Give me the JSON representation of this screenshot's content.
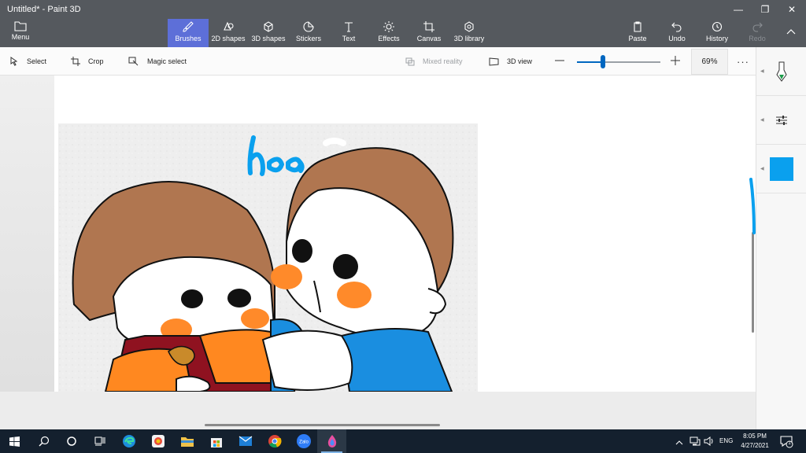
{
  "window": {
    "title": "Untitled* - Paint 3D",
    "minimize": "—",
    "maximize": "❐",
    "close": "✕"
  },
  "ribbon": {
    "menu_label": "Menu",
    "tools": [
      {
        "label": "Brushes"
      },
      {
        "label": "2D shapes"
      },
      {
        "label": "3D shapes"
      },
      {
        "label": "Stickers"
      },
      {
        "label": "Text"
      },
      {
        "label": "Effects"
      },
      {
        "label": "Canvas"
      },
      {
        "label": "3D library"
      }
    ],
    "actions": [
      {
        "label": "Paste"
      },
      {
        "label": "Undo"
      },
      {
        "label": "History"
      },
      {
        "label": "Redo"
      }
    ]
  },
  "toolbar": {
    "select_label": "Select",
    "crop_label": "Crop",
    "magic_select_label": "Magic select",
    "mixed_reality_label": "Mixed reality",
    "view_3d_label": "3D view",
    "zoom_value": "69%",
    "zoom_level": 0.69,
    "more_label": "···"
  },
  "canvas": {
    "sketch_text": "hoo"
  },
  "side_panel": {
    "active_color": "#0aa0ee"
  },
  "taskbar": {
    "apps": [
      "windows-start-icon",
      "search-icon",
      "cortana-icon",
      "task-view-icon",
      "edge-icon",
      "photos-icon",
      "file-explorer-icon",
      "store-icon",
      "mail-icon",
      "chrome-icon",
      "zalo-icon",
      "paint3d-icon"
    ],
    "zalo_label": "Zalo",
    "language": "ENG",
    "time": "8:05 PM",
    "date": "4/27/2021",
    "notification_count": "1"
  },
  "colors": {
    "accent": "#5d6fd8",
    "brand_blue": "#0067c0"
  }
}
